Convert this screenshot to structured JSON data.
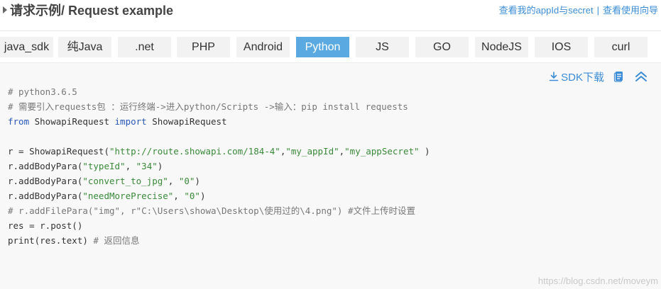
{
  "header": {
    "title": "请求示例/ Request example",
    "link_appid": "查看我的appId与secret",
    "separator": "|",
    "link_guide": "查看使用向导"
  },
  "tabs": [
    {
      "label": "java_sdk",
      "active": false
    },
    {
      "label": "纯Java",
      "active": false
    },
    {
      "label": ".net",
      "active": false
    },
    {
      "label": "PHP",
      "active": false
    },
    {
      "label": "Android",
      "active": false
    },
    {
      "label": "Python",
      "active": true
    },
    {
      "label": "JS",
      "active": false
    },
    {
      "label": "GO",
      "active": false
    },
    {
      "label": "NodeJS",
      "active": false
    },
    {
      "label": "IOS",
      "active": false
    },
    {
      "label": "curl",
      "active": false
    }
  ],
  "toolbar": {
    "sdk_download": "SDK下载",
    "icons": [
      "download-icon",
      "copy-icon",
      "collapse-icon"
    ]
  },
  "code": {
    "lines": [
      [
        {
          "t": "# python3.6.5",
          "c": "cm"
        }
      ],
      [
        {
          "t": "# 需要引入requests包 ：运行终端->进入python/Scripts ->输入：pip install requests",
          "c": "cm"
        }
      ],
      [
        {
          "t": "from",
          "c": "kw"
        },
        {
          "t": " ShowapiRequest ",
          "c": "pl"
        },
        {
          "t": "import",
          "c": "kw"
        },
        {
          "t": " ShowapiRequest",
          "c": "pl"
        }
      ],
      [
        {
          "t": "",
          "c": "pl"
        }
      ],
      [
        {
          "t": "r = ShowapiRequest(",
          "c": "pl"
        },
        {
          "t": "\"http://route.showapi.com/184-4\"",
          "c": "str"
        },
        {
          "t": ",",
          "c": "pl"
        },
        {
          "t": "\"my_appId\"",
          "c": "str"
        },
        {
          "t": ",",
          "c": "pl"
        },
        {
          "t": "\"my_appSecret\"",
          "c": "str"
        },
        {
          "t": " )",
          "c": "pl"
        }
      ],
      [
        {
          "t": "r.addBodyPara(",
          "c": "pl"
        },
        {
          "t": "\"typeId\"",
          "c": "str"
        },
        {
          "t": ", ",
          "c": "pl"
        },
        {
          "t": "\"34\"",
          "c": "str"
        },
        {
          "t": ")",
          "c": "pl"
        }
      ],
      [
        {
          "t": "r.addBodyPara(",
          "c": "pl"
        },
        {
          "t": "\"convert_to_jpg\"",
          "c": "str"
        },
        {
          "t": ", ",
          "c": "pl"
        },
        {
          "t": "\"0\"",
          "c": "str"
        },
        {
          "t": ")",
          "c": "pl"
        }
      ],
      [
        {
          "t": "r.addBodyPara(",
          "c": "pl"
        },
        {
          "t": "\"needMorePrecise\"",
          "c": "str"
        },
        {
          "t": ", ",
          "c": "pl"
        },
        {
          "t": "\"0\"",
          "c": "str"
        },
        {
          "t": ")",
          "c": "pl"
        }
      ],
      [
        {
          "t": "# r.addFilePara(\"img\", r\"C:\\Users\\showa\\Desktop\\使用过的\\4.png\") #文件上传时设置",
          "c": "cm"
        }
      ],
      [
        {
          "t": "res = r.post()",
          "c": "pl"
        }
      ],
      [
        {
          "t": "print(res.text) ",
          "c": "pl"
        },
        {
          "t": "# 返回信息",
          "c": "cm"
        }
      ]
    ]
  },
  "watermark": "https://blog.csdn.net/moveym",
  "colors": {
    "accent": "#3c8dd6",
    "active_tab": "#5aa9e0",
    "tab_bg": "#f2f2f2",
    "code_bg": "#f8f8f8"
  }
}
